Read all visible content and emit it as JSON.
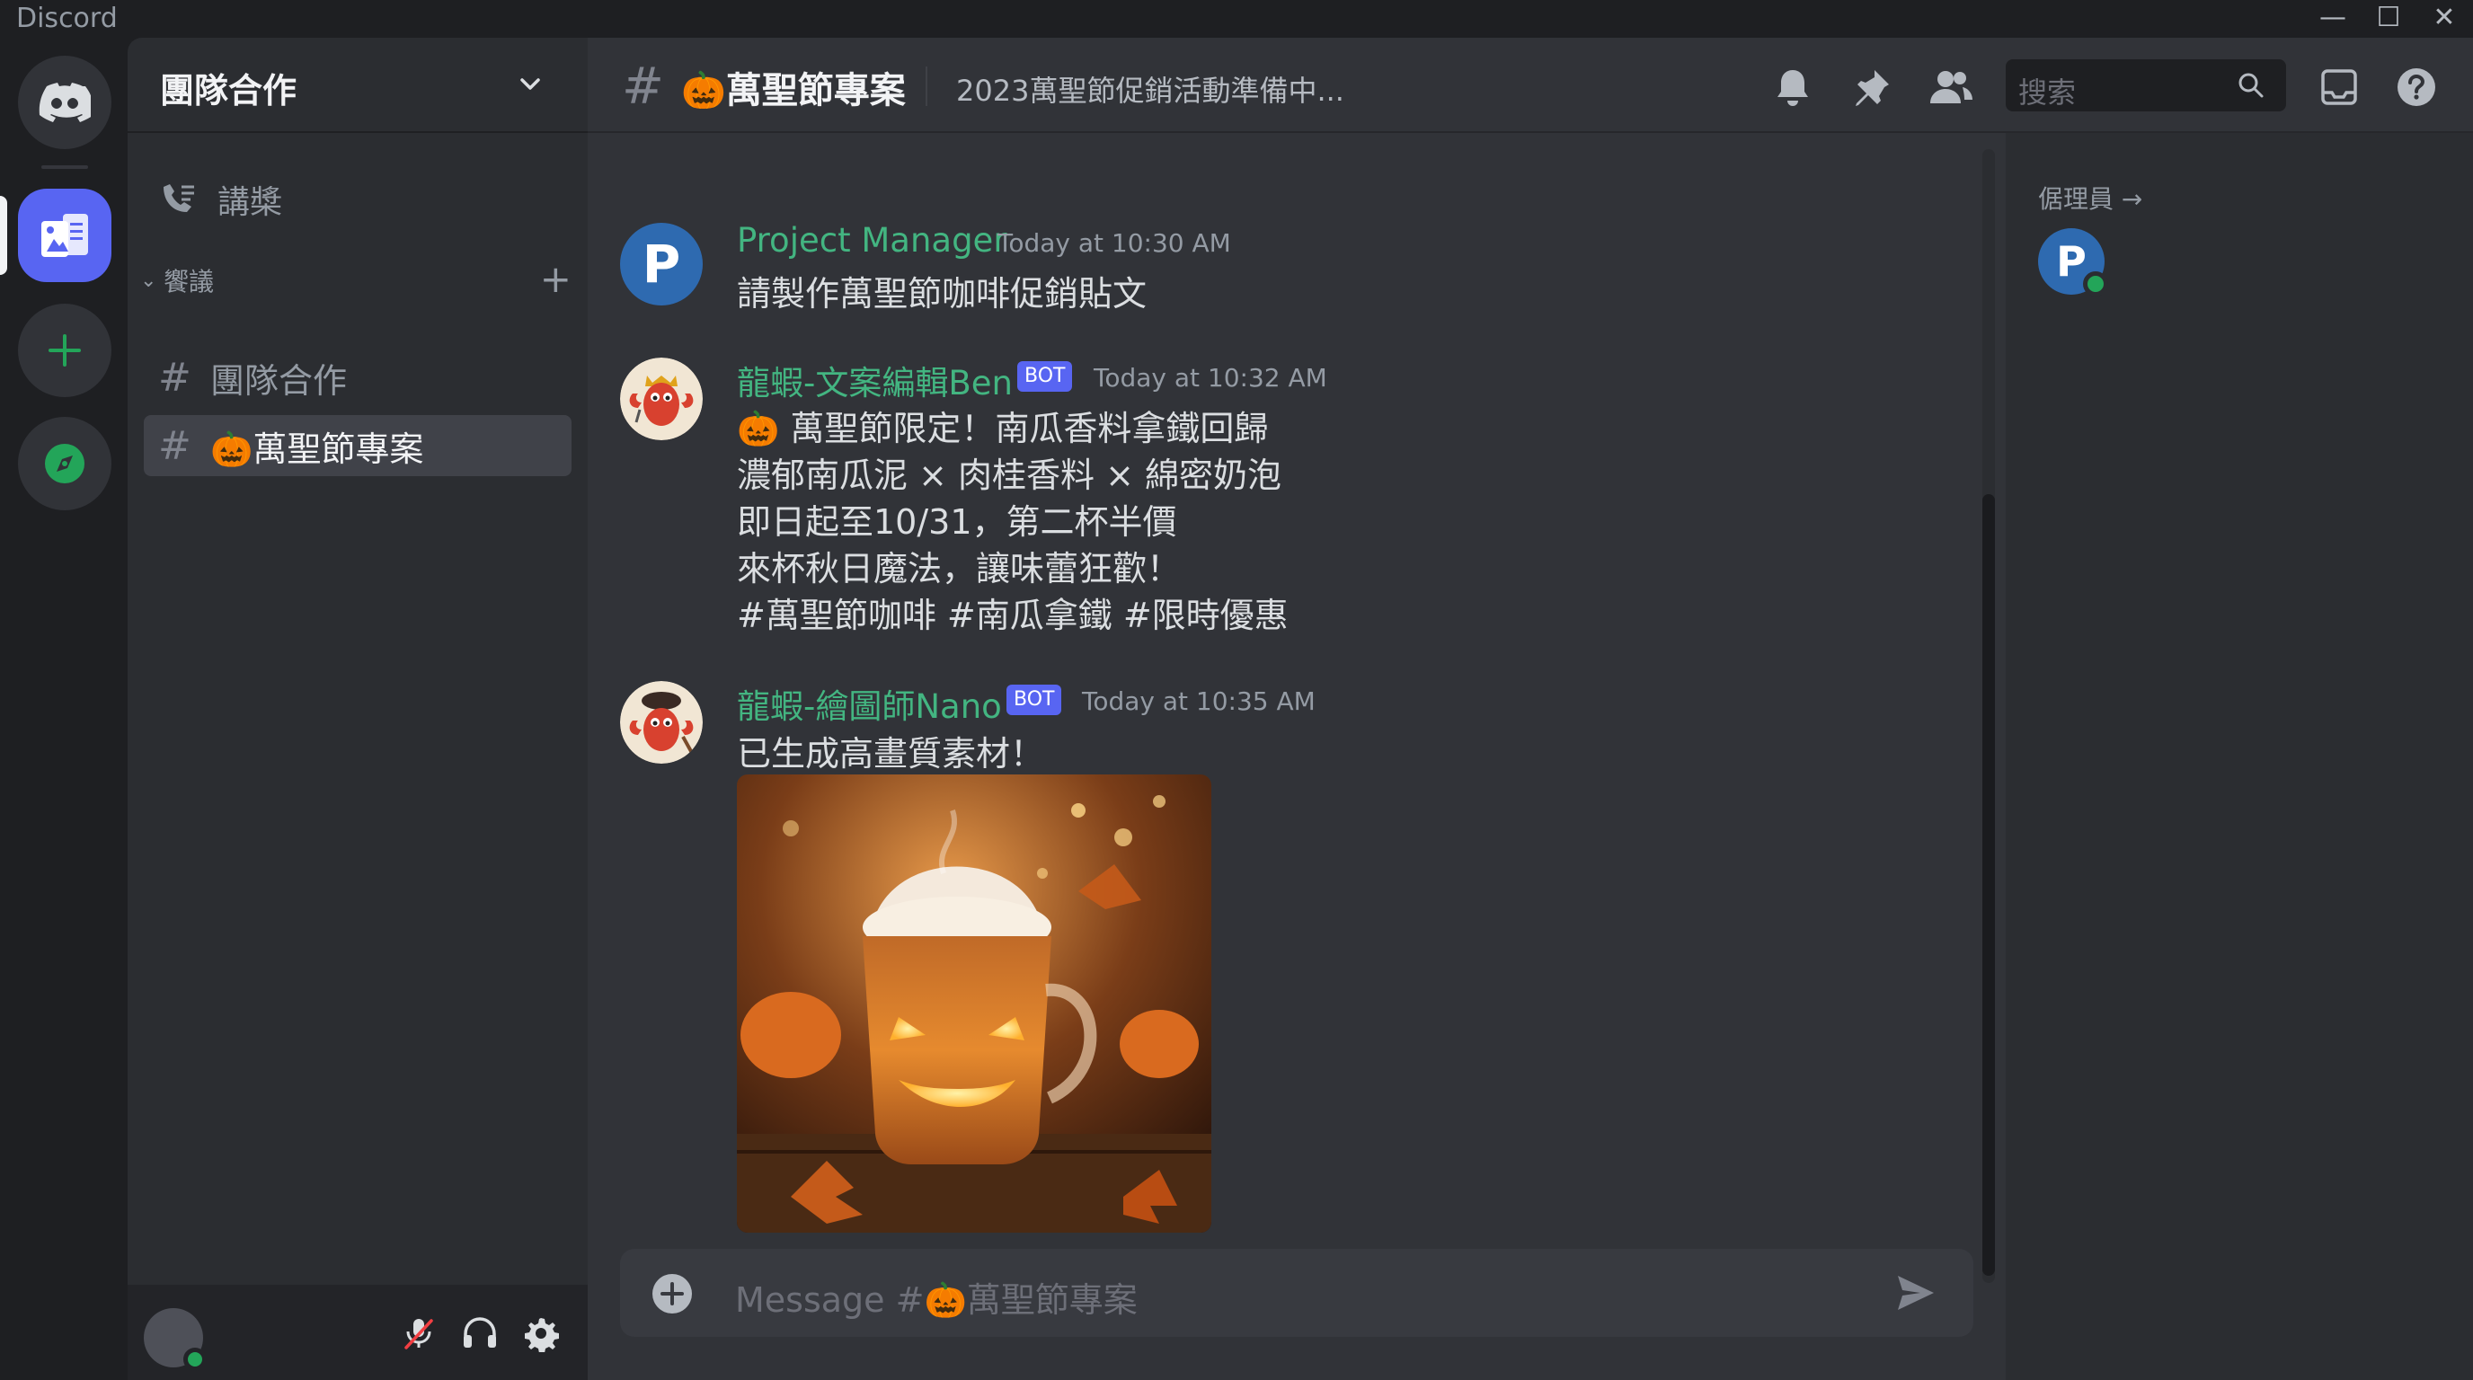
{
  "window": {
    "title": "Discord",
    "controls": {
      "minimize": "—",
      "maximize": "☐",
      "close": "✕"
    }
  },
  "server_rail": {
    "items": [
      {
        "name": "home",
        "icon": "discord-logo-icon"
      },
      {
        "name": "團隊合作",
        "icon": "server-icon",
        "selected": true
      },
      {
        "name": "add-server",
        "icon": "plus-icon"
      },
      {
        "name": "explore",
        "icon": "compass-icon"
      }
    ]
  },
  "sidebar": {
    "server_name": "團隊合作",
    "voice_channel": "講槳",
    "category": "饗議",
    "channels": [
      {
        "name": "團隊合作",
        "selected": false
      },
      {
        "name": "🎃萬聖節專案",
        "selected": true
      }
    ]
  },
  "user_panel": {
    "status_color": "#23a559",
    "icons": [
      "mic-muted-icon",
      "headset-icon",
      "gear-icon"
    ]
  },
  "header": {
    "channel_name": "🎃萬聖節專案",
    "topic": "2023萬聖節促銷活動準備中...",
    "search_placeholder": "搜索",
    "icons": [
      "bell-icon",
      "pin-icon",
      "members-icon",
      "search-icon",
      "inbox-icon",
      "help-icon"
    ]
  },
  "messages": [
    {
      "author": "Project Manager",
      "author_color": "#43b581",
      "bot": false,
      "time": "Today at 10:30 AM",
      "avatar_letter": "P",
      "lines": [
        "請製作萬聖節咖啡促銷貼文"
      ]
    },
    {
      "author": "龍蝦-文案編輯Ben",
      "author_color": "#43b581",
      "bot": true,
      "bot_label": "BOT",
      "time": "Today at 10:32 AM",
      "lines": [
        "🎃 萬聖節限定！南瓜香料拿鐵回歸",
        "濃郁南瓜泥 × 肉桂香料 × 綿密奶泡",
        "即日起至10/31，第二杯半價",
        "來杯秋日魔法，讓味蕾狂歡！",
        "#萬聖節咖啡 #南瓜拿鐵 #限時優惠"
      ]
    },
    {
      "author": "龍蝦-繪圖師Nano",
      "author_color": "#43b581",
      "bot": true,
      "bot_label": "BOT",
      "time": "Today at 10:35 AM",
      "lines": [
        "已生成高畫質素材！"
      ],
      "attachment": "jack-o-lantern-latte-image"
    }
  ],
  "composer": {
    "placeholder": "Message #🎃萬聖節專案"
  },
  "members": {
    "heading": "倨理員 →",
    "list": [
      {
        "avatar_letter": "P",
        "status": "online"
      }
    ]
  },
  "colors": {
    "accent": "#5865f2",
    "online": "#23a559",
    "author": "#43b581"
  }
}
